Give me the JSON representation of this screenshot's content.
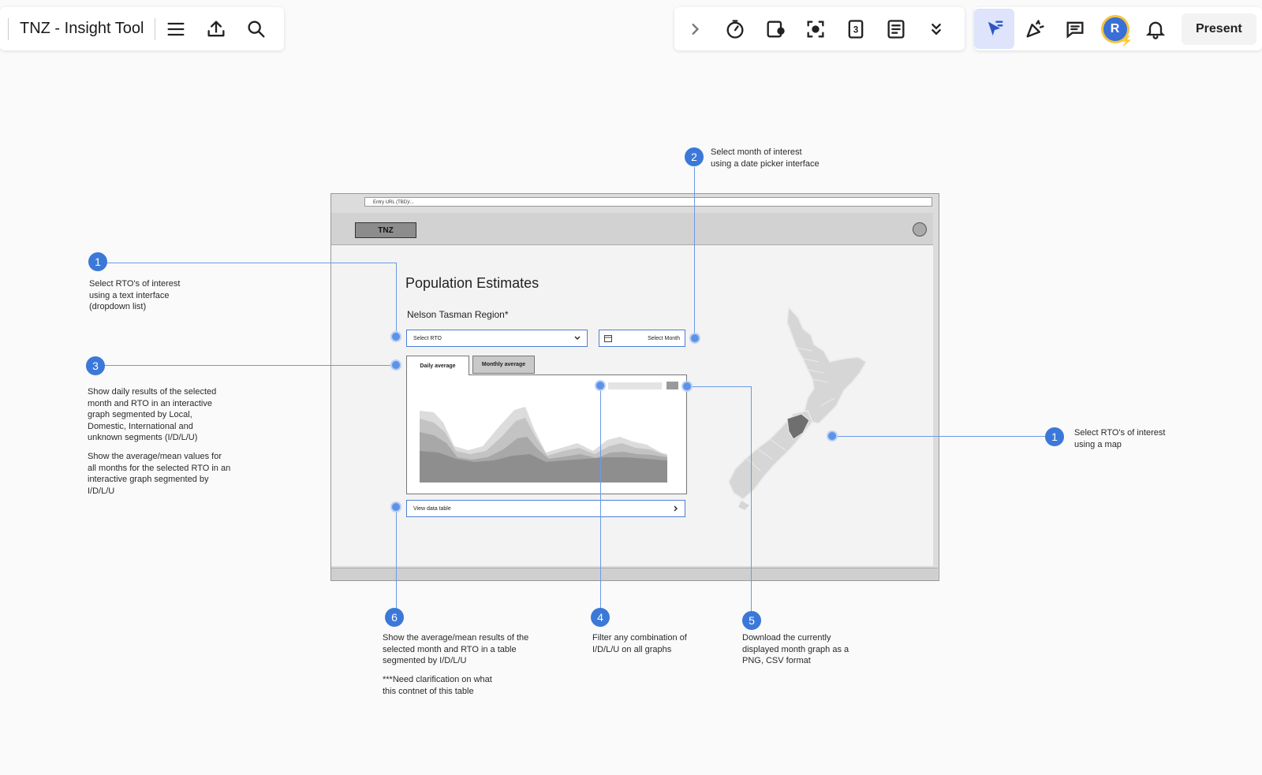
{
  "toolbar": {
    "board_title": "TNZ - Insight Tool",
    "present_label": "Present",
    "avatar_initial": "R"
  },
  "wireframe": {
    "url": "Entry URL (TBD)/...",
    "logo": "TNZ",
    "page_title": "Population Estimates",
    "region": "Nelson Tasman Region*",
    "rto_select": "Select RTO",
    "month_select": "Select Month",
    "tabs": [
      "Daily average",
      "Monthly average"
    ],
    "data_table": "View data table"
  },
  "annotations": {
    "a1_left": {
      "num": "1",
      "text": "Select RTO's of interest\nusing a text interface\n(dropdown list)"
    },
    "a1_right": {
      "num": "1",
      "text": "Select RTO's of interest\nusing a map"
    },
    "a2": {
      "num": "2",
      "text": "Select month of interest\nusing a date picker interface"
    },
    "a3": {
      "num": "3",
      "text": "Show daily results of the selected\nmonth and RTO in an interactive\ngraph segmented by Local,\nDomestic, International and\nunknown segments (I/D/L/U)",
      "text2": "Show the average/mean values for\nall months for the selected RTO in an\ninteractive graph segmented by\nI/D/L/U"
    },
    "a4": {
      "num": "4",
      "text": "Filter any combination of\nI/D/L/U on all graphs"
    },
    "a5": {
      "num": "5",
      "text": "Download the currently\ndisplayed month graph as a\nPNG, CSV format"
    },
    "a6": {
      "num": "6",
      "text": "Show the average/mean results of the\nselected month and RTO in a table\nsegmented by I/D/L/U",
      "text2": "***Need clarification on what\nthis contnet of this table"
    }
  },
  "colors": {
    "accent": "#3b78d8",
    "connector": "#6a9ae6",
    "highlight": "#dde4fb"
  }
}
